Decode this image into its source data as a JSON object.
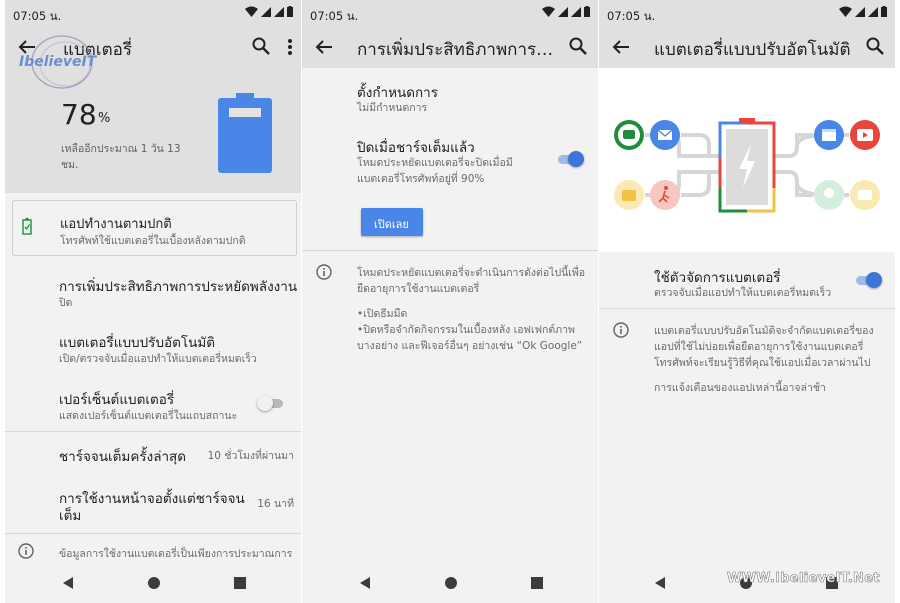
{
  "status_bar": {
    "time": "07:05 น."
  },
  "colors": {
    "accent": "#3d74d9",
    "battery_blue": "#4a86e8",
    "header_gray": "#e0e0e0",
    "button": "#4a86e8"
  },
  "screen1": {
    "title": "แบตเตอรี่",
    "watermark": "IbelieveIT",
    "percent": "78",
    "percent_unit": "%",
    "remaining_line1": "เหลืออีกประมาณ 1 วัน 13",
    "remaining_line2": "ชม.",
    "card": {
      "title": "แอปทำงานตามปกติ",
      "subtitle": "โทรศัพท์ใช้แบตเตอรี่ในเบื้องหลังตามปกติ"
    },
    "items": [
      {
        "title": "การเพิ่มประสิทธิภาพการประหยัดพลังงาน",
        "subtitle": "ปิด"
      },
      {
        "title": "แบตเตอรี่แบบปรับอัตโนมัติ",
        "subtitle": "เปิด/ตรวจจับเมื่อแอปทำให้แบตเตอรี่หมดเร็ว"
      },
      {
        "title": "เปอร์เซ็นต์แบตเตอรี่",
        "subtitle": "แสดงเปอร์เซ็นต์แบตเตอรี่ในแถบสถานะ",
        "switch_on": false
      }
    ],
    "last_charge": {
      "label": "ชาร์จจนเต็มครั้งล่าสุด",
      "value": "10 ชั่วโมงที่ผ่านมา"
    },
    "screen_usage": {
      "label_line1": "การใช้งานหน้าจอตั้งแต่ชาร์จจน",
      "label_line2": "เต็ม",
      "value": "16 นาที"
    },
    "info_text": "ข้อมูลการใช้งานแบตเตอรี่เป็นเพียงการประมาณการ"
  },
  "screen2": {
    "title": "การเพิ่มประสิทธิภาพการประ...",
    "schedule": {
      "title": "ตั้งกำหนดการ",
      "subtitle": "ไม่มีกำหนดการ"
    },
    "full_charge": {
      "title": "ปิดเมื่อชาร์จเต็มแล้ว",
      "subtitle_line1": "โหมดประหยัดแบตเตอรี่จะปิดเมื่อมี",
      "subtitle_line2": "แบตเตอรี่โทรศัพท์อยู่ที่ 90%",
      "switch_on": true
    },
    "button_label": "เปิดเลย",
    "info_line1": "โหมดประหยัดแบตเตอรี่จะดำเนินการดังต่อไปนี้เพื่อ",
    "info_line2": "ยืดอายุการใช้งานแบตเตอรี่",
    "bullet1": "•เปิดธีมมืด",
    "bullet2_line1": "•ปิดหรือจำกัดกิจกรรมในเบื้องหลัง เอฟเฟกต์ภาพ",
    "bullet2_line2": "บางอย่าง และฟีเจอร์อื่นๆ อย่างเช่น “Ok Google”"
  },
  "screen3": {
    "title": "แบตเตอรี่แบบปรับอัตโนมัติ",
    "manager": {
      "title": "ใช้ตัวจัดการแบตเตอรี่",
      "subtitle": "ตรวจจับเมื่อแอปทำให้แบตเตอรี่หมดเร็ว",
      "switch_on": true
    },
    "info_line1": "แบตเตอรี่แบบปรับอัตโนมัติจะจำกัดแบตเตอรี่ของ",
    "info_line2": "แอปที่ใช้ไม่บ่อยเพื่อยืดอายุการใช้งานแบตเตอรี่",
    "info_line3": "โทรศัพท์จะเรียนรู้วิธีที่คุณใช้แอปเมื่อเวลาผ่านไป",
    "notice": "การแจ้งเตือนของแอปเหล่านี้อาจล่าช้า",
    "watermark": "WWW.IbelieveIT.Net"
  }
}
